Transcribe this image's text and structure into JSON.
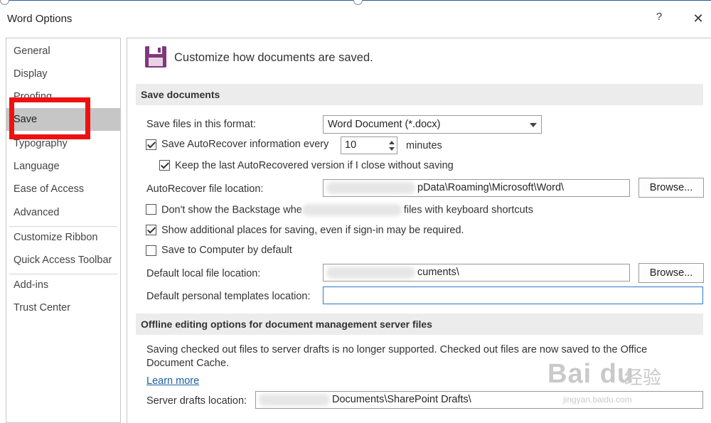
{
  "window": {
    "title": "Word Options",
    "help_label": "?",
    "close_label": "✕"
  },
  "sidebar": {
    "items": [
      {
        "label": "General"
      },
      {
        "label": "Display"
      },
      {
        "label": "Proofing"
      },
      {
        "label": "Save"
      },
      {
        "label": "Typography"
      },
      {
        "label": "Language"
      },
      {
        "label": "Ease of Access"
      },
      {
        "label": "Advanced"
      },
      {
        "label": "Customize Ribbon"
      },
      {
        "label": "Quick Access Toolbar"
      },
      {
        "label": "Add-ins"
      },
      {
        "label": "Trust Center"
      }
    ],
    "selected": "Save"
  },
  "header": {
    "text": "Customize how documents are saved."
  },
  "save_documents": {
    "section_title": "Save documents",
    "format_label": "Save files in this format:",
    "format_value": "Word Document (*.docx)",
    "autorecover_label": "Save AutoRecover information every",
    "autorecover_checked": true,
    "autorecover_minutes": "10",
    "minutes_label": "minutes",
    "keep_last_label": "Keep the last AutoRecovered version if I close without saving",
    "keep_last_checked": true,
    "autorecover_location_label": "AutoRecover file location:",
    "autorecover_location_value": "pData\\Roaming\\Microsoft\\Word\\",
    "browse_label": "Browse...",
    "backstage_label": "Don't show the Backstage when opening or saving files with keyboard shortcuts",
    "backstage_label_a": "Don't show the Backstage whe",
    "backstage_label_b": "files with keyboard shortcuts",
    "backstage_checked": false,
    "additional_places_label": "Show additional places for saving, even if sign-in may be required.",
    "additional_places_checked": true,
    "save_to_computer_label": "Save to Computer by default",
    "save_to_computer_checked": false,
    "default_local_label": "Default local file location:",
    "default_local_value": "cuments\\",
    "default_templates_label": "Default personal templates location:",
    "default_templates_value": ""
  },
  "offline": {
    "section_title": "Offline editing options for document management server files",
    "info_line1": "Saving checked out files to server drafts is no longer supported. Checked out files are now saved to the Office",
    "info_line2": "Document Cache.",
    "learn_more": "Learn more",
    "server_drafts_label": "Server drafts location:",
    "server_drafts_value": "Documents\\SharePoint Drafts\\"
  },
  "watermark": {
    "logo": "Bai du",
    "cn": "经验",
    "url": "jingyan.baidu.com"
  },
  "colors": {
    "accent": "#2b579a",
    "highlight_box": "#ee1111",
    "selected_nav": "#c6c6c6",
    "link": "#1a5ea8",
    "save_icon": "#80397b"
  }
}
